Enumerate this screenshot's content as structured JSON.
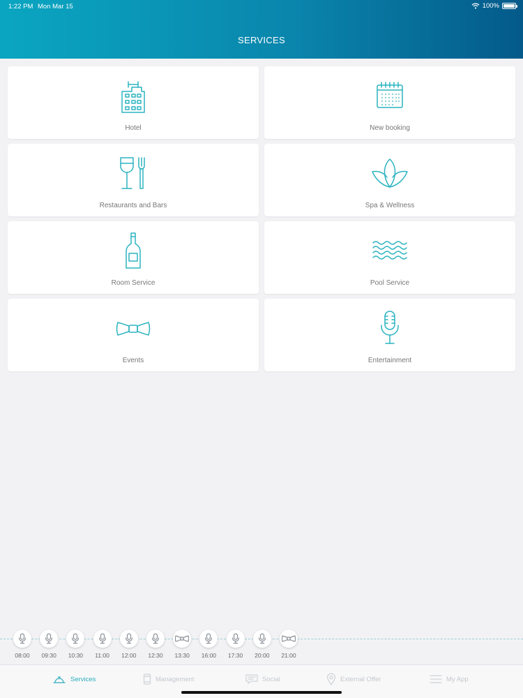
{
  "status_bar": {
    "time": "1:22 PM",
    "date": "Mon Mar 15",
    "battery": "100%"
  },
  "header": {
    "title": "SERVICES"
  },
  "services": [
    {
      "label": "Hotel",
      "icon": "hotel-icon"
    },
    {
      "label": "New booking",
      "icon": "calendar-icon"
    },
    {
      "label": "Restaurants and Bars",
      "icon": "wine-fork-icon"
    },
    {
      "label": "Spa & Wellness",
      "icon": "lotus-icon"
    },
    {
      "label": "Room Service",
      "icon": "bottle-icon"
    },
    {
      "label": "Pool Service",
      "icon": "waves-icon"
    },
    {
      "label": "Events",
      "icon": "bowtie-icon"
    },
    {
      "label": "Entertainment",
      "icon": "microphone-icon"
    }
  ],
  "timeline": [
    {
      "time": "08:00",
      "icon": "microphone-icon"
    },
    {
      "time": "09:30",
      "icon": "microphone-icon"
    },
    {
      "time": "10:30",
      "icon": "microphone-icon"
    },
    {
      "time": "11:00",
      "icon": "microphone-icon"
    },
    {
      "time": "12:00",
      "icon": "microphone-icon"
    },
    {
      "time": "12:30",
      "icon": "microphone-icon"
    },
    {
      "time": "13:30",
      "icon": "bowtie-icon"
    },
    {
      "time": "16:00",
      "icon": "microphone-icon"
    },
    {
      "time": "17:30",
      "icon": "microphone-icon"
    },
    {
      "time": "20:00",
      "icon": "microphone-icon"
    },
    {
      "time": "21:00",
      "icon": "bowtie-icon"
    }
  ],
  "tabs": [
    {
      "label": "Services",
      "icon": "bell-icon",
      "active": true
    },
    {
      "label": "Management",
      "icon": "phone-icon",
      "active": false
    },
    {
      "label": "Social",
      "icon": "chat-icon",
      "active": false
    },
    {
      "label": "External Offer",
      "icon": "location-pin-icon",
      "active": false
    },
    {
      "label": "My App",
      "icon": "menu-icon",
      "active": false
    }
  ],
  "colors": {
    "accent": "#2bb3c0",
    "header_start": "#0aa6c1",
    "header_end": "#045a8a",
    "background": "#f2f2f5"
  }
}
